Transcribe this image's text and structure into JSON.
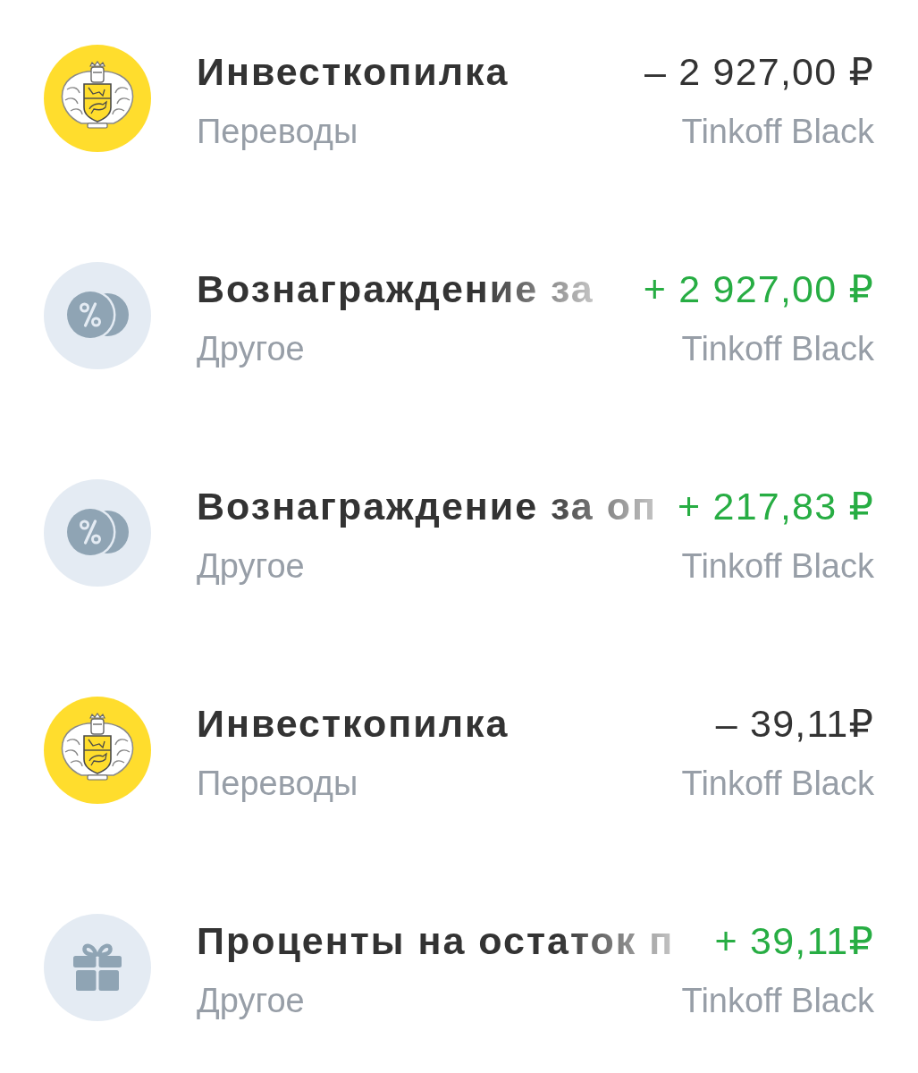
{
  "transactions": [
    {
      "kind": "emblem",
      "title": "Инвесткопилка",
      "faded": false,
      "amount": "– 2 927,00 ₽",
      "incoming": false,
      "category": "Переводы",
      "account": "Tinkoff Black"
    },
    {
      "kind": "reward",
      "title": "Вознаграждение за",
      "faded": true,
      "amount": "+ 2 927,00 ₽",
      "incoming": true,
      "category": "Другое",
      "account": "Tinkoff Black"
    },
    {
      "kind": "reward",
      "title": "Вознаграждение за оп",
      "faded": true,
      "amount": "+ 217,83 ₽",
      "incoming": true,
      "category": "Другое",
      "account": "Tinkoff Black"
    },
    {
      "kind": "emblem",
      "title": "Инвесткопилка",
      "faded": false,
      "amount": "– 39,11₽",
      "incoming": false,
      "category": "Переводы",
      "account": "Tinkoff Black"
    },
    {
      "kind": "gift",
      "title": "Проценты на остаток п",
      "faded": true,
      "amount": "+ 39,11₽",
      "incoming": true,
      "category": "Другое",
      "account": "Tinkoff Black"
    }
  ]
}
